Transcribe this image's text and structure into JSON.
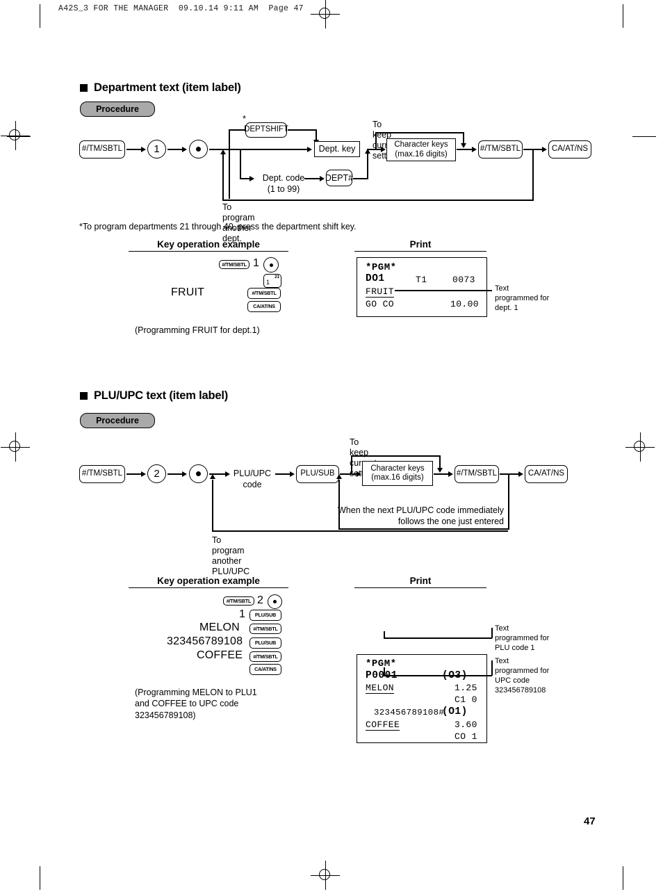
{
  "page": {
    "header_line": "A42S_3 FOR THE MANAGER  09.10.14 9:11 AM  Page 47",
    "page_number": "47"
  },
  "sections": [
    {
      "title": "Department text (item label)",
      "procedure_label": "Procedure",
      "flow": {
        "start_key": "#/TM/SBTL",
        "mode_number": "1",
        "dot": "•",
        "asterisk": "*",
        "dept_shift_key": "DEPTSHIFT",
        "dept_key": "Dept. key",
        "dept_code_label": "Dept. code",
        "dept_code_range": "(1 to 99)",
        "dept_hash_key": "DEPT#",
        "keep_setting_label": "To keep current setting",
        "char_keys_line1": "Character keys",
        "char_keys_line2": "(max.16 digits)",
        "subtotal_key": "#/TM/SBTL",
        "end_key": "CA/AT/NS",
        "loop_label": "To program another dept."
      },
      "footnote": "*To program departments 21 through 40, press the department shift key.",
      "example_header": "Key operation example",
      "print_header": "Print",
      "example": {
        "row1_key": "#/TM/SBTL",
        "row1_num": "1",
        "row1_dot": "•",
        "row2_key_main": "1",
        "row2_key_sup": "21",
        "row3_text": "FRUIT",
        "row3_key": "#/TM/SBTL",
        "row4_key": "CA/AT/NS",
        "caption": "(Programming FRUIT for dept.1)"
      },
      "receipt": {
        "l1": "*PGM*",
        "l2_a": "DO1",
        "l2_b": "T1",
        "l2_c": "0073",
        "l3": "FRUIT",
        "l4_a": "GO CO",
        "l4_b": "10.00"
      },
      "callouts": [
        {
          "lines": [
            "Text",
            "programmed for",
            "dept. 1"
          ]
        }
      ]
    },
    {
      "title": "PLU/UPC text (item label)",
      "procedure_label": "Procedure",
      "flow": {
        "start_key": "#/TM/SBTL",
        "mode_number": "2",
        "dot": "•",
        "code_label_line1": "PLU/UPC",
        "code_label_line2": "code",
        "plu_sub_key": "PLU/SUB",
        "keep_setting_label": "To keep current setting",
        "char_keys_line1": "Character keys",
        "char_keys_line2": "(max.16 digits)",
        "subtotal_key": "#/TM/SBTL",
        "end_key": "CA/AT/NS",
        "inner_loop_line1": "When the next PLU/UPC code immediately",
        "inner_loop_line2": "follows the one just entered",
        "loop_label": "To program another PLU/UPC"
      },
      "example_header": "Key operation example",
      "print_header": "Print",
      "example": {
        "r1_key": "#/TM/SBTL",
        "r1_num": "2",
        "r1_dot": "•",
        "r2_num": "1",
        "r2_key": "PLU/SUB",
        "r3_text": "MELON",
        "r3_key": "#/TM/SBTL",
        "r4_text": "323456789108",
        "r4_key": "PLU/SUB",
        "r5_text": "COFFEE",
        "r5_key": "#/TM/SBTL",
        "r6_key": "CA/AT/NS",
        "caption_l1": "(Programming MELON to PLU1",
        "caption_l2": "and COFFEE to UPC code",
        "caption_l3": "323456789108)"
      },
      "receipt": {
        "l1": "*PGM*",
        "l2_a": "P0001",
        "l2_b": "(O3)",
        "l3_a": "MELON",
        "l3_b": "1.25",
        "l4": "C1 0",
        "l5_a": "323456789108#",
        "l5_b": "(O1)",
        "l6_a": "COFFEE",
        "l6_b": "3.60",
        "l7": "CO 1"
      },
      "callouts": [
        {
          "lines": [
            "Text",
            "programmed for",
            "PLU code 1"
          ]
        },
        {
          "lines": [
            "Text",
            "programmed for",
            "UPC code",
            "323456789108"
          ]
        }
      ]
    }
  ]
}
